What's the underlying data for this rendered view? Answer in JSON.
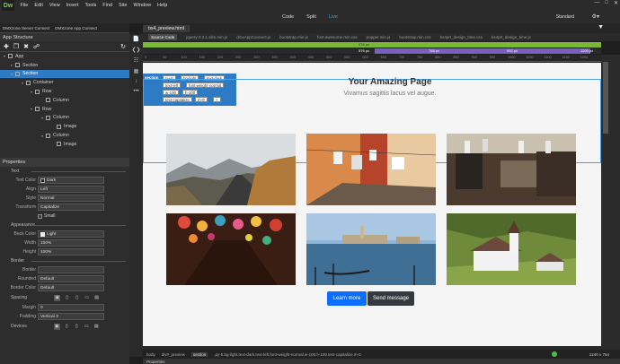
{
  "app": {
    "logo": "Dw",
    "workspace": "Standard"
  },
  "menu": [
    "File",
    "Edit",
    "View",
    "Insert",
    "Tools",
    "Find",
    "Site",
    "Window",
    "Help"
  ],
  "view_modes": [
    "Code",
    "Split",
    "Live"
  ],
  "view_active": "Live",
  "left_tabs": [
    "DMXzone Server Connect",
    "DMXzone App Connect"
  ],
  "app_structure": {
    "title": "App Structure",
    "tree": [
      {
        "label": "App",
        "depth": 0
      },
      {
        "label": "Section",
        "depth": 1
      },
      {
        "label": "Section",
        "depth": 1,
        "selected": true
      },
      {
        "label": "Container",
        "depth": 2
      },
      {
        "label": "Row",
        "depth": 3
      },
      {
        "label": "Column",
        "depth": 4
      },
      {
        "label": "Row",
        "depth": 3
      },
      {
        "label": "Column",
        "depth": 4
      },
      {
        "label": "Image",
        "depth": 5
      },
      {
        "label": "Column",
        "depth": 4
      },
      {
        "label": "Image",
        "depth": 5
      }
    ]
  },
  "properties": {
    "title": "Properties",
    "text_section": "Text",
    "text_color_label": "Text Color",
    "text_color": "Dark",
    "align_label": "Align",
    "align": "Left",
    "style_label": "Style",
    "style": "Normal",
    "transform_label": "Transform",
    "transform": "Capitalize",
    "small_label": "Small",
    "appearance_section": "Appearance",
    "back_color_label": "Back Color",
    "back_color": "Light",
    "width_label": "Width",
    "width": "100%",
    "height_label": "Height",
    "height": "100%",
    "border_section": "Border",
    "border_label": "Border",
    "border": "",
    "rounded_label": "Rounded",
    "rounded": "Default",
    "border_color_label": "Border Color",
    "border_color": "Default",
    "spacing_section": "Spacing",
    "margin_label": "Margin",
    "margin": "0",
    "padding_label": "Padding",
    "padding": "Vertical 3",
    "devices_section": "Devices"
  },
  "document": {
    "tab": "bs4_preview.html",
    "files": [
      "Source Code",
      "jquery-3.3.1.slim.min.js",
      "dmxAppConnect.js",
      "bootstrap.min.js",
      "font-awesome.min.css",
      "popper.min.js",
      "bootstrap.min.css",
      "bs4prt_design_time.css",
      "bs4prt_design_time.js"
    ]
  },
  "media_queries": {
    "green_labels": [
      "576 px"
    ],
    "purple_labels": [
      "576 px",
      "768 px",
      "992 px",
      "1200 px"
    ]
  },
  "ruler": [
    "0",
    "50",
    "100",
    "150",
    "200",
    "250",
    "300",
    "350",
    "400",
    "450",
    "500",
    "550",
    "600",
    "650",
    "700",
    "750",
    "800",
    "850",
    "900",
    "950",
    "1000",
    "1050",
    "1100",
    "1150",
    "1200"
  ],
  "element_tag": {
    "name": "section",
    "classes": [
      "py-5",
      "bg-light",
      "text-dark",
      "text-left",
      "font-weight-normal",
      "w-100",
      "h-100",
      "text-capitalize",
      "m-0"
    ]
  },
  "page": {
    "heading": "Your Amazing Page",
    "subheading": "Vivamus sagittis lacus vel augue.",
    "btn_primary": "Learn more",
    "btn_dark": "Send message"
  },
  "status": {
    "crumbs": [
      "body",
      "div#_preview",
      "section"
    ],
    "selector": ".py-5.bg-light.text-dark.text-left.font-weight-normal.w-100.h-100.text-capitalize.m-0",
    "dimensions": "1240 x 764"
  },
  "bottom_tab": "Properties",
  "colors": {
    "accent": "#2da8e6",
    "selection": "#2c7bc4",
    "primary": "#0d6efd",
    "dark": "#343a40",
    "mq_green": "#7cb932",
    "mq_purple": "#7761b9"
  }
}
